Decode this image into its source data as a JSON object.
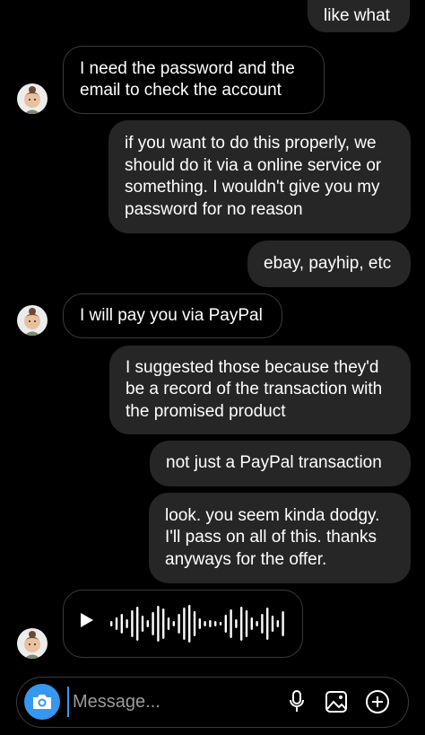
{
  "messages": [
    {
      "dir": "sent",
      "text": "like what"
    },
    {
      "dir": "received",
      "text": "I need the password and the email to check the account"
    },
    {
      "dir": "sent",
      "text": "if you want to do this properly, we should do it via a online service or something. I wouldn't give you my password for no reason"
    },
    {
      "dir": "sent",
      "text": "ebay, payhip, etc"
    },
    {
      "dir": "received",
      "text": "I will pay you via PayPal"
    },
    {
      "dir": "sent",
      "text": "I suggested those because they'd be a record of the transaction with the promised product"
    },
    {
      "dir": "sent",
      "text": "not just a PayPal transaction"
    },
    {
      "dir": "sent",
      "text": "look. you seem kinda dodgy. I'll pass on all of this. thanks anyways for the offer."
    },
    {
      "dir": "received",
      "type": "voice"
    }
  ],
  "composer": {
    "placeholder": "Message...",
    "icons": [
      "camera-icon",
      "microphone-icon",
      "gallery-icon",
      "add-icon"
    ],
    "accent": "#3797f0"
  },
  "icons": {
    "voice_play": "play-icon",
    "avatar": "avatar"
  }
}
